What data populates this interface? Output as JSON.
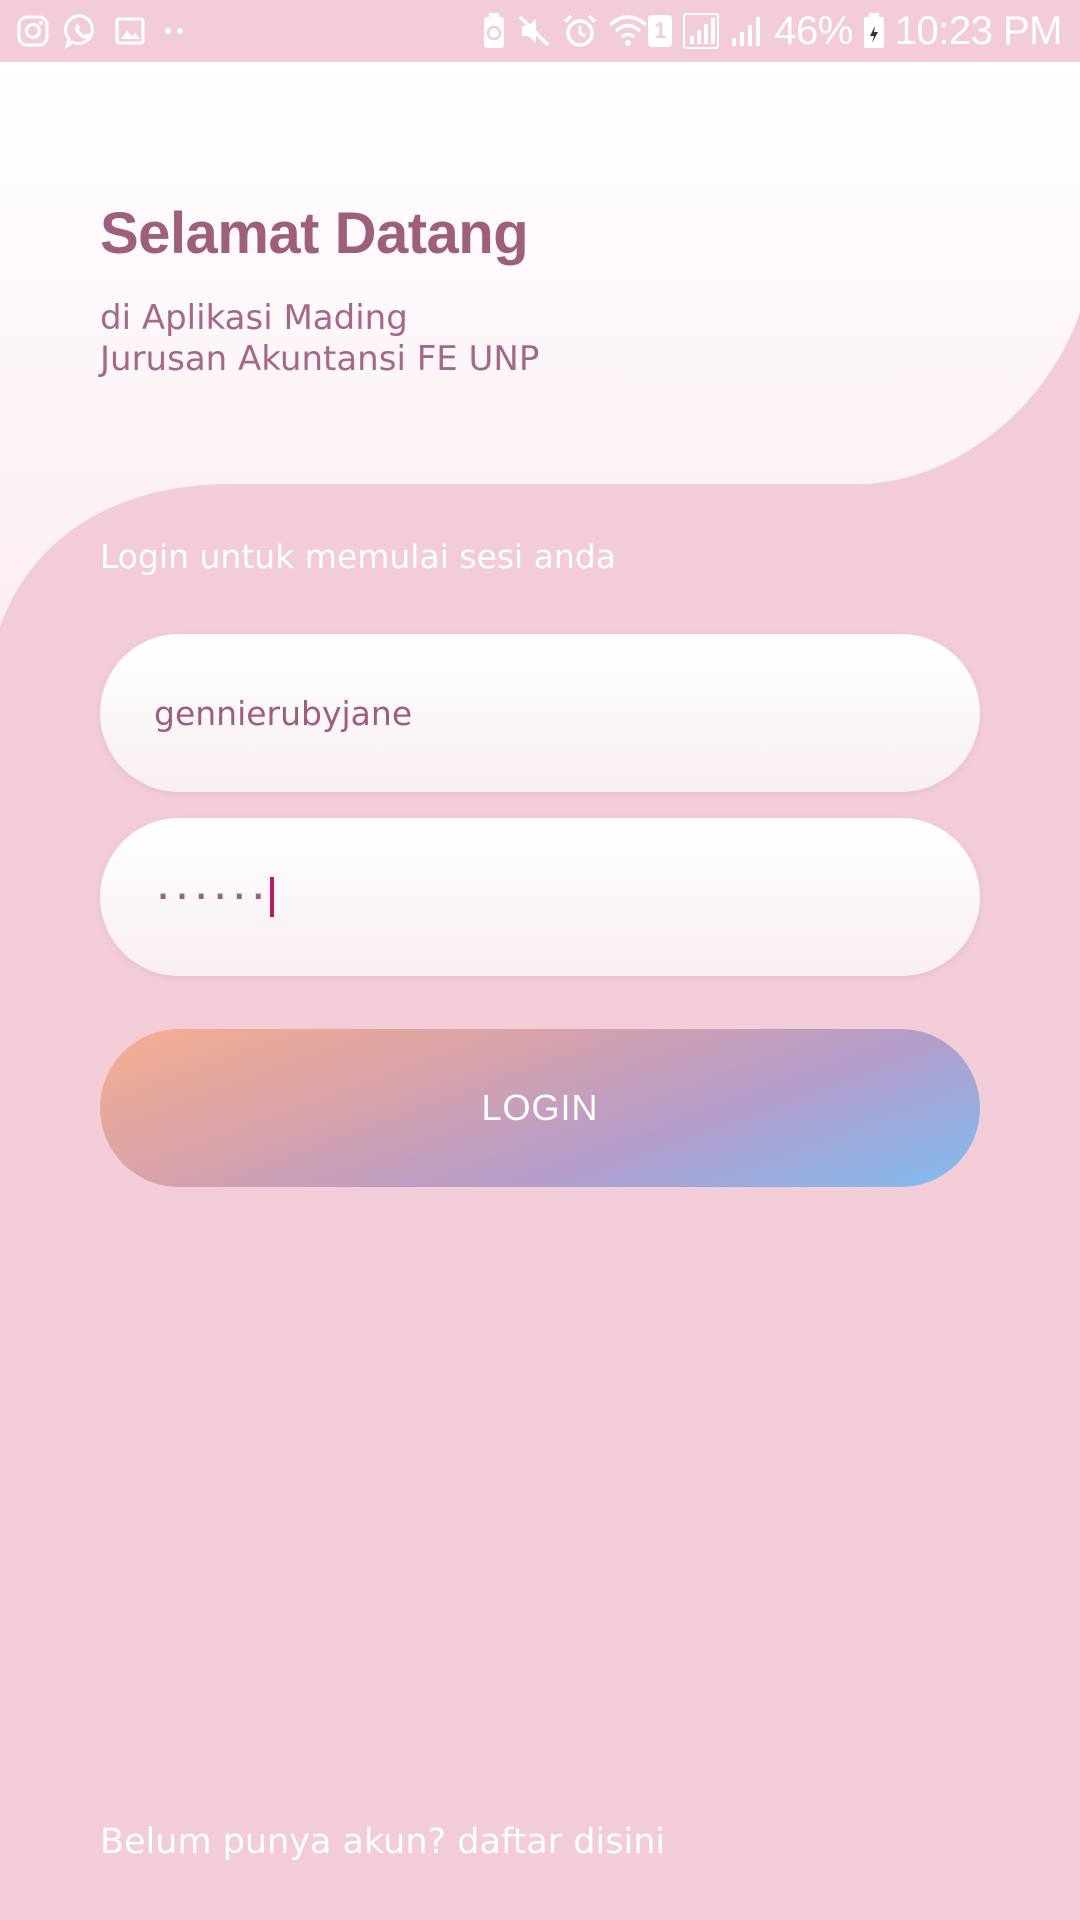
{
  "status_bar": {
    "battery": "46%",
    "time": "10:23 PM",
    "sim_badge": "1",
    "left_icons": [
      "instagram-icon",
      "whatsapp-icon",
      "gallery-icon",
      "more-dots-icon"
    ],
    "right_icons": [
      "battery-saver-icon",
      "mute-icon",
      "alarm-icon",
      "wifi-icon",
      "sim-badge",
      "signal-icon",
      "signal-icon-2",
      "battery-icon"
    ]
  },
  "header": {
    "title": "Selamat Datang",
    "subtitle_line1": "di Aplikasi Mading",
    "subtitle_line2": "Jurusan Akuntansi FE UNP"
  },
  "form": {
    "hint": "Login untuk memulai sesi anda",
    "username_value": "gennierubyjane",
    "password_masked": "······",
    "login_label": "LOGIN"
  },
  "footer": {
    "register_text": "Belum punya akun? daftar disini"
  },
  "colors": {
    "background": "#f2ccd6",
    "title": "#9e5f7d",
    "cursor": "#c2185b",
    "button_gradient_start": "#f6ae8e",
    "button_gradient_end": "#80bdf0"
  }
}
